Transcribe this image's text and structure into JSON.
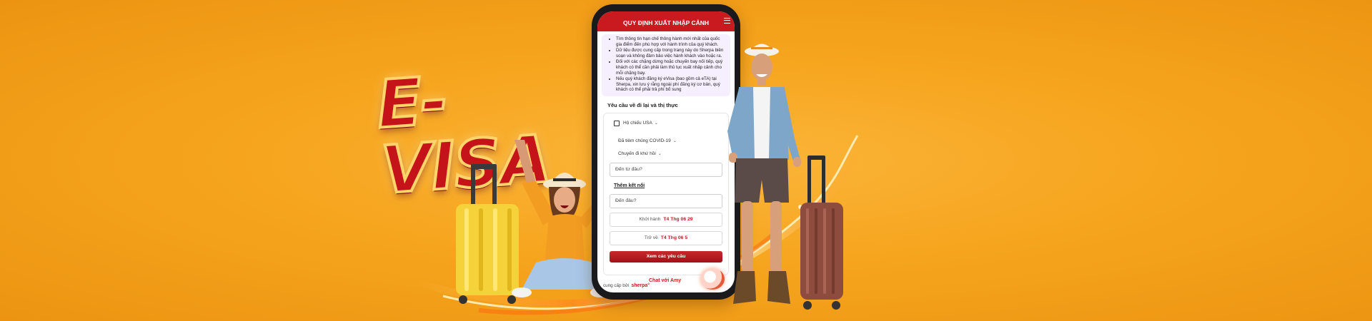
{
  "banner": {
    "headline": "E-VISA"
  },
  "phone": {
    "header_title": "QUY ĐỊNH XUẤT NHẬP CẢNH",
    "notes": [
      "Tìm thông tin hạn chế thông hành mới nhất của quốc gia điểm đến phù hợp với hành trình của quý khách.",
      "Dữ liệu được cung cấp trong trang này do Sherpa biên soạn và không đảm bảo việc hành khách vào hoặc ra.",
      "Đối với các chặng dừng hoặc chuyến bay nối tiếp, quý khách có thể cần phải làm thủ tục xuất nhập cảnh cho mỗi chặng bay.",
      "Nếu quý khách đăng ký eVisa (bao gồm cả eTA) tại Sherpa, xin lưu ý rằng ngoài phí đăng ký cơ bản, quý khách có thể phải trả phí bổ sung"
    ],
    "section_title": "Yêu cầu về đi lại và thị thực",
    "passport_option": "Hộ chiếu USA",
    "vaccine_option": "Đã tiêm chủng COVID-19",
    "trip_option": "Chuyến đi khứ hồi",
    "origin_placeholder": "Đến từ đâu?",
    "add_connection": "Thêm kết nối",
    "destination_placeholder": "Đến đâu?",
    "depart_label": "Khởi hành",
    "depart_date": "T4 Thg 06 29",
    "return_label": "Trở về",
    "return_date": "T4 Thg 06 5",
    "cta_label": "Xem các yêu cầu",
    "footer_prefix": "cung cấp bởi",
    "footer_brand": "sherpa°",
    "chat_label": "Chat với Amy"
  },
  "icons": {
    "menu": "menu-icon",
    "passport": "passport-box-icon",
    "chevron": "chevron-down-icon"
  },
  "colors": {
    "background": "#f6a51e",
    "brand_red": "#c81a1f"
  }
}
